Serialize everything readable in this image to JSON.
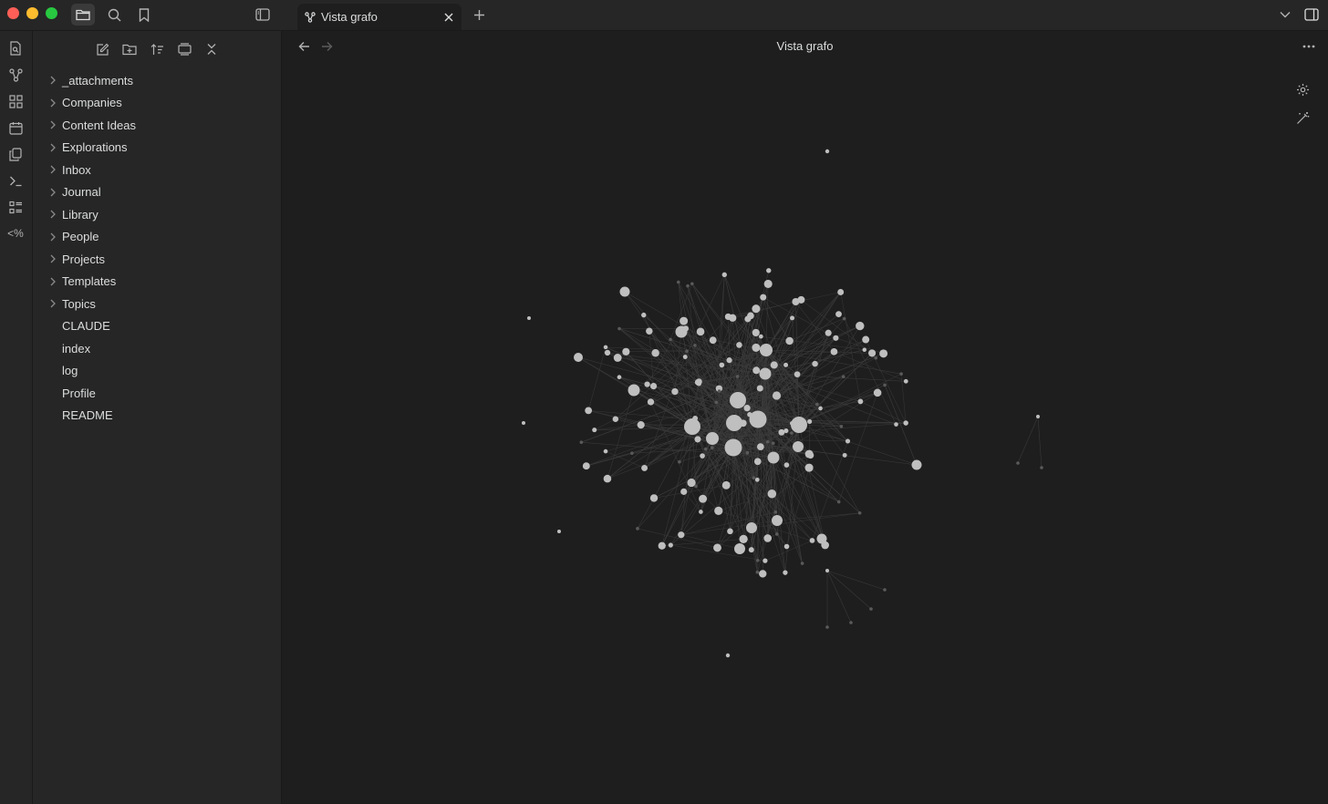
{
  "window": {
    "tab_title": "Vista grafo",
    "view_title": "Vista grafo"
  },
  "sidebar": {
    "items": [
      {
        "label": "_attachments",
        "type": "folder"
      },
      {
        "label": "Companies",
        "type": "folder"
      },
      {
        "label": "Content Ideas",
        "type": "folder"
      },
      {
        "label": "Explorations",
        "type": "folder"
      },
      {
        "label": "Inbox",
        "type": "folder"
      },
      {
        "label": "Journal",
        "type": "folder"
      },
      {
        "label": "Library",
        "type": "folder"
      },
      {
        "label": "People",
        "type": "folder"
      },
      {
        "label": "Projects",
        "type": "folder"
      },
      {
        "label": "Templates",
        "type": "folder"
      },
      {
        "label": "Topics",
        "type": "folder"
      },
      {
        "label": "CLAUDE",
        "type": "file"
      },
      {
        "label": "index",
        "type": "file"
      },
      {
        "label": "log",
        "type": "file"
      },
      {
        "label": "Profile",
        "type": "file"
      },
      {
        "label": "README",
        "type": "file"
      }
    ]
  },
  "ribbon": {
    "icons": [
      "file-search-icon",
      "graph-icon",
      "canvas-icon",
      "daily-note-icon",
      "copy-icon",
      "terminal-icon",
      "outline-icon",
      "templater-icon"
    ],
    "templater_label": "<%"
  },
  "graph": {
    "node_color": "#bfbfbf",
    "dim_node_color": "#5a5a5a",
    "edge_color": "#3c3c3c"
  }
}
